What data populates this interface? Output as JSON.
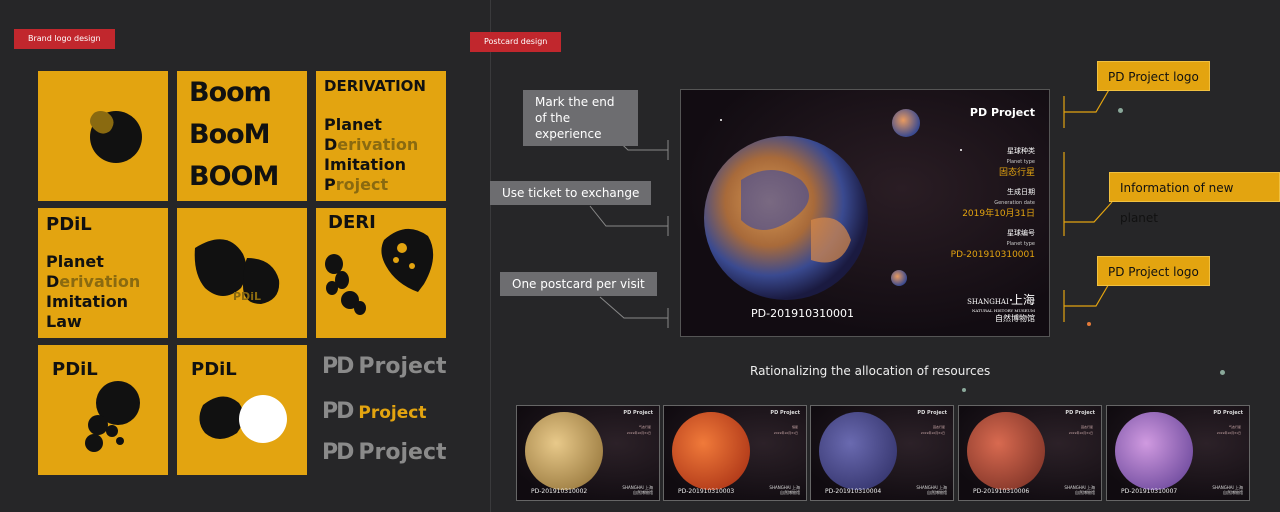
{
  "left_section": {
    "tag": "Brand logo design",
    "boom_lines": [
      "Boom",
      "BooM",
      "BOOM"
    ],
    "derivation_title": "DERIVATION",
    "derivation_words": [
      {
        "initial": "P",
        "rest": "lanet"
      },
      {
        "initial": "D",
        "rest": "erivation"
      },
      {
        "initial": "I",
        "rest": "mitation"
      },
      {
        "initial": "P",
        "rest": "roject"
      }
    ],
    "pdil_title": "PDiL",
    "pdil_words": [
      {
        "initial": "P",
        "rest": "lanet"
      },
      {
        "initial": "D",
        "rest": "erivation"
      },
      {
        "initial": "I",
        "rest": "mitation"
      },
      {
        "initial": "L",
        "rest": "aw"
      }
    ],
    "pdil_mark_label": "PDiL",
    "deri_title": "DERI",
    "pdil_blob_title": "PDiL",
    "pdil_duo_title": "PDiL",
    "pd_rows": [
      {
        "mark": "PD",
        "word": "Project"
      },
      {
        "mark": "PD",
        "word": "Project"
      },
      {
        "mark": "PD",
        "word": "Project"
      }
    ],
    "colors": {
      "brand_yellow": "#e3a410",
      "dark": "#111111",
      "gray": "#8a8a8a"
    }
  },
  "right_section": {
    "tag": "Postcard design",
    "callouts_left": [
      "Mark the end of the experience",
      "Use ticket to exchange",
      "One postcard per visit"
    ],
    "callouts_right": [
      "PD Project logo",
      "Information of new planet",
      "PD Project logo"
    ],
    "postcard": {
      "logo": "PD Project",
      "planet_type_cn": "星球种类",
      "planet_type_en": "Planet type",
      "planet_type_value": "固态行星",
      "gen_date_cn": "生成日期",
      "gen_date_en": "Generation date",
      "gen_date_value": "2019年10月31日",
      "planet_no_cn": "星球编号",
      "planet_no_en": "Planet type",
      "planet_no_value": "PD-201910310001",
      "museum_en": "SHANGHAI",
      "museum_en2": "NATURAL HISTORY MUSEUM",
      "museum_cn1": "上海",
      "museum_cn2": "自然博物馆",
      "id": "PD-201910310001"
    },
    "caption": "Rationalizing the allocation of resources",
    "thumbnails": [
      {
        "id": "PD-201910310002",
        "logo": "PD Project",
        "value": "气态行星",
        "color1": "#e8c98a",
        "color2": "#8a6a30"
      },
      {
        "id": "PD-201910310003",
        "logo": "PD Project",
        "value": "恒星",
        "color1": "#f07a3a",
        "color2": "#a02810"
      },
      {
        "id": "PD-201910310004",
        "logo": "PD Project",
        "value": "固态行星",
        "color1": "#6a6ab0",
        "color2": "#2a2a60"
      },
      {
        "id": "PD-201910310006",
        "logo": "PD Project",
        "value": "固态行星",
        "color1": "#d86a50",
        "color2": "#702a20"
      },
      {
        "id": "PD-201910310007",
        "logo": "PD Project",
        "value": "气态行星",
        "color1": "#d09ae0",
        "color2": "#5a3a90"
      }
    ],
    "thumb_date": "2019年10月31日",
    "thumb_museum": "SHANGHAI 上海",
    "thumb_museum_cn": "自然博物馆"
  }
}
